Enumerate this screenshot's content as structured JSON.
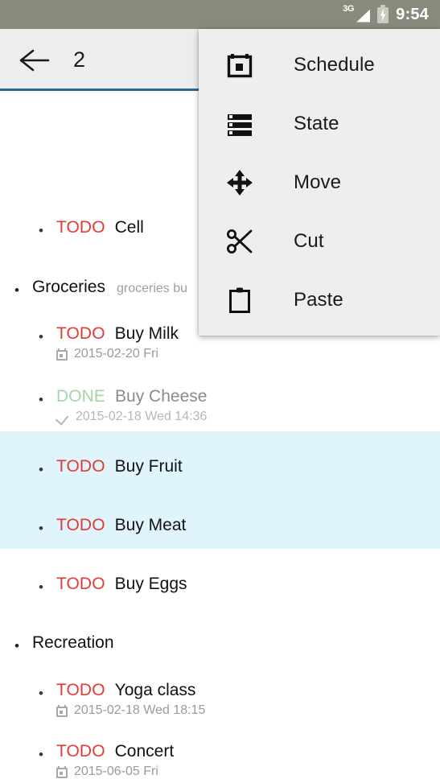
{
  "status_bar": {
    "network": "3G",
    "network_icon": "signal-triangle-icon",
    "battery_icon": "battery-charging-icon",
    "time": "9:54"
  },
  "toolbar": {
    "back_icon": "back-arrow-icon",
    "selected_count": "2"
  },
  "colors": {
    "status_bar_bg": "#8a8a7c",
    "toolbar_bg": "#eceded",
    "accent_underline": "#2c6b8f",
    "selection_bg": "#e0f4fc",
    "menu_bg": "#eeeeee",
    "todo_keyword": "#e53935",
    "done_keyword": "#a5d6a7",
    "meta_text": "#9a9a9a"
  },
  "menu": {
    "items": [
      {
        "label": "Schedule",
        "icon": "calendar-icon"
      },
      {
        "label": "State",
        "icon": "state-list-icon"
      },
      {
        "label": "Move",
        "icon": "move-arrows-icon"
      },
      {
        "label": "Cut",
        "icon": "scissors-icon"
      },
      {
        "label": "Paste",
        "icon": "clipboard-icon"
      }
    ]
  },
  "notes": [
    {
      "keyword": "TODO",
      "title": "Cell",
      "subtitle": "",
      "meta": "",
      "meta_icon": "",
      "indent": 2,
      "selected": false,
      "done": false
    },
    {
      "keyword": "",
      "title": "Groceries",
      "subtitle": "groceries bu",
      "meta": "",
      "meta_icon": "",
      "indent": 1,
      "selected": false,
      "done": false
    },
    {
      "keyword": "TODO",
      "title": "Buy Milk",
      "subtitle": "",
      "meta": "2015-02-20 Fri",
      "meta_icon": "calendar-icon",
      "indent": 2,
      "selected": false,
      "done": false
    },
    {
      "keyword": "DONE",
      "title": "Buy Cheese",
      "subtitle": "",
      "meta": "2015-02-18 Wed 14:36",
      "meta_icon": "check-icon",
      "indent": 2,
      "selected": false,
      "done": true
    },
    {
      "keyword": "TODO",
      "title": "Buy Fruit",
      "subtitle": "",
      "meta": "",
      "meta_icon": "",
      "indent": 2,
      "selected": true,
      "done": false
    },
    {
      "keyword": "TODO",
      "title": "Buy Meat",
      "subtitle": "",
      "meta": "",
      "meta_icon": "",
      "indent": 2,
      "selected": true,
      "done": false
    },
    {
      "keyword": "TODO",
      "title": "Buy Eggs",
      "subtitle": "",
      "meta": "",
      "meta_icon": "",
      "indent": 2,
      "selected": false,
      "done": false
    },
    {
      "keyword": "",
      "title": "Recreation",
      "subtitle": "",
      "meta": "",
      "meta_icon": "",
      "indent": 1,
      "selected": false,
      "done": false
    },
    {
      "keyword": "TODO",
      "title": "Yoga class",
      "subtitle": "",
      "meta": "2015-02-18 Wed 18:15",
      "meta_icon": "calendar-icon",
      "indent": 2,
      "selected": false,
      "done": false
    },
    {
      "keyword": "TODO",
      "title": "Concert",
      "subtitle": "",
      "meta": "2015-06-05 Fri",
      "meta_icon": "calendar-icon",
      "indent": 2,
      "selected": false,
      "done": false
    }
  ]
}
